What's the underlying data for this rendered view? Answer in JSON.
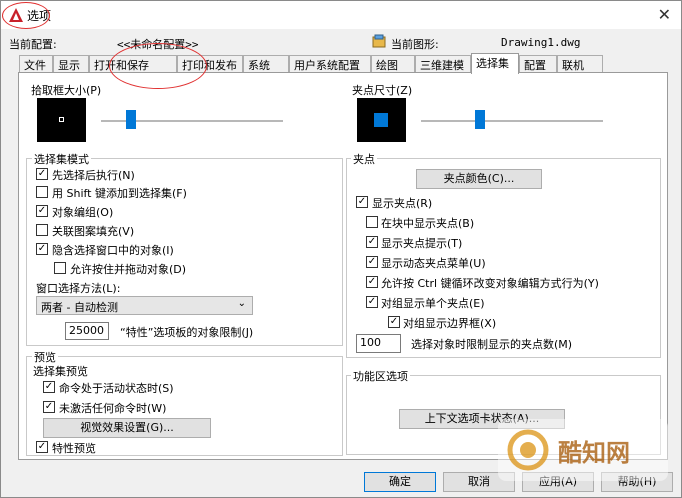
{
  "window": {
    "title": "选项",
    "close_glyph": "✕",
    "current_profile_label": "当前配置:",
    "current_profile_value": "<<未命名配置>>",
    "current_drawing_label": "当前图形:",
    "current_drawing_value": "Drawing1.dwg"
  },
  "tabs": [
    {
      "label": "文件"
    },
    {
      "label": "显示"
    },
    {
      "label": "打开和保存"
    },
    {
      "label": "打印和发布"
    },
    {
      "label": "系统"
    },
    {
      "label": "用户系统配置"
    },
    {
      "label": "绘图"
    },
    {
      "label": "三维建模"
    },
    {
      "label": "选择集"
    },
    {
      "label": "配置"
    },
    {
      "label": "联机"
    }
  ],
  "active_tab": "选择集",
  "pickbox": {
    "title": "拾取框大小(P)",
    "slider_level": 0.3
  },
  "grip_size": {
    "title": "夹点尺寸(Z)",
    "slider_level": 0.48
  },
  "selection_modes": {
    "title": "选择集模式",
    "items": [
      {
        "label": "先选择后执行(N)",
        "checked": true
      },
      {
        "label": "用 Shift 键添加到选择集(F)",
        "checked": false
      },
      {
        "label": "对象编组(O)",
        "checked": true
      },
      {
        "label": "关联图案填充(V)",
        "checked": false
      },
      {
        "label": "隐含选择窗口中的对象(I)",
        "checked": true
      },
      {
        "label": "允许按住并拖动对象(D)",
        "checked": false
      }
    ],
    "window_method_label": "窗口选择方法(L):",
    "window_method_value": "两者 - 自动检测",
    "limit_value": "25000",
    "limit_label": "“特性”选项板的对象限制(J)"
  },
  "grips": {
    "title": "夹点",
    "color_button": "夹点颜色(C)...",
    "items": [
      {
        "label": "显示夹点(R)",
        "checked": true
      },
      {
        "label": "在块中显示夹点(B)",
        "checked": false
      },
      {
        "label": "显示夹点提示(T)",
        "checked": true
      },
      {
        "label": "显示动态夹点菜单(U)",
        "checked": true
      },
      {
        "label": "允许按 Ctrl 键循环改变对象编辑方式行为(Y)",
        "checked": true
      },
      {
        "label": "对组显示单个夹点(E)",
        "checked": true
      },
      {
        "label": "对组显示边界框(X)",
        "checked": true
      }
    ],
    "limit_value": "100",
    "limit_label": "选择对象时限制显示的夹点数(M)"
  },
  "preview": {
    "title": "预览",
    "subtitle": "选择集预览",
    "items": [
      {
        "label": "命令处于活动状态时(S)",
        "checked": true
      },
      {
        "label": "未激活任何命令时(W)",
        "checked": true
      }
    ],
    "effects_button": "视觉效果设置(G)...",
    "property_preview": {
      "label": "特性预览",
      "checked": true
    }
  },
  "ribbon": {
    "title": "功能区选项",
    "context_button": "上下文选项卡状态(A)..."
  },
  "footer": {
    "ok": "确定",
    "cancel": "取消",
    "apply": "应用(A)",
    "help": "帮助(H)"
  },
  "watermark": {
    "text": "酷知网"
  },
  "colors": {
    "accent": "#0078d7",
    "annotation": "#e03030"
  }
}
